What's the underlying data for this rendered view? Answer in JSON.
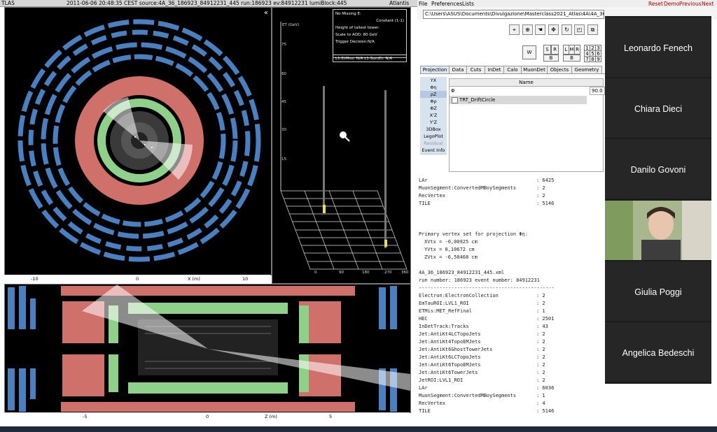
{
  "atlantis": {
    "header": {
      "left": "TLAS",
      "center": "2011-06-06 20:48:35 CEST source:4A_36_186923_84912231_445 run:186923 ev:84912231 lumiBlock:445",
      "right": "Atlantis"
    },
    "yx_axis": {
      "ticks": [
        "-10",
        "0",
        "10"
      ],
      "label": "X (m)"
    },
    "rz_axis": {
      "ticks": [
        "-5",
        "0",
        "5"
      ],
      "label": "Z (m)"
    },
    "lego": {
      "info_lines": [
        "No Missing E:",
        "Constant (1-1)",
        "Height of tallest tower:",
        "Scale to AOD: 80 GeV",
        "Trigger Decision:N/A"
      ],
      "l1_line": "L1-EtMiss: N/A L1-SumEt: N/A",
      "y_title": "ET (GeV)",
      "y_ticks": [
        "75",
        "60",
        "45",
        "30",
        "15"
      ],
      "x_ticks": [
        "0",
        "90",
        "180",
        "270",
        "360"
      ],
      "depth_ticks": [
        "-5",
        "-4",
        "-3",
        "-2",
        "-1",
        "0",
        "1",
        "2",
        "3",
        "4",
        "5"
      ]
    }
  },
  "gui": {
    "menu": [
      "File",
      "Preferences",
      "Lists"
    ],
    "menu_right": [
      "Reset",
      "Demo",
      "Previous",
      "Next"
    ],
    "path": "C:\\Users\\ASUS\\Documents\\Divulgazione\\Masterclass2021_Atlas\\4A\\4A_36_186923_84912231_445.xml",
    "window_buttons": {
      "w": "W",
      "s": "S",
      "r": "R",
      "b": "B",
      "l": "L",
      "m": "M",
      "r2": "R",
      "b2": "B",
      "grid": [
        "1",
        "2",
        "3",
        "4",
        "5",
        "6",
        "7",
        "8",
        "9"
      ]
    },
    "tabs": [
      "Projection",
      "Data",
      "Cuts",
      "InDet",
      "Calo",
      "MuonDet",
      "Objects",
      "Geometry"
    ],
    "projections": [
      "YX",
      "Φη",
      "ρZ",
      "Φρ",
      "ΦZ",
      "X'Z",
      "Y'Z",
      "3DBox",
      "LegoPlot",
      "Residual",
      "Event Info"
    ],
    "table": {
      "header": "Name",
      "row1_label": "Φ",
      "row1_value": "90.0",
      "row2_label": "TRT_DriftCircle"
    },
    "console": {
      "top_lines": [
        {
          "k": "LAr",
          "v": ": 6425"
        },
        {
          "k": "MuonSegment:ConvertedMBoySegments",
          "v": ": 2"
        },
        {
          "k": "RecVertex",
          "v": ": 2"
        },
        {
          "k": "TILE",
          "v": ": 5146"
        }
      ],
      "vertex_title": "Primary vertex set for projection Φη:",
      "vertex_lines": [
        "XVtx = -0,00925 cm",
        "YVtx = 0,10672 cm",
        "ZVtx = -6,50468 cm"
      ],
      "file": "4A_36_186923_84912231_445.xml",
      "run_line": "run number: 186923 event number: 84912231",
      "separator": "----------------------------------------------",
      "collections": [
        {
          "k": "Electron:ElectronCollection",
          "v": ": 2"
        },
        {
          "k": "EmTauROI:LVL1_ROI",
          "v": ": 2"
        },
        {
          "k": "ETMis:MET_RefFinal",
          "v": ": 1"
        },
        {
          "k": "HEC",
          "v": ": 2501"
        },
        {
          "k": "InDetTrack:Tracks",
          "v": ": 43"
        },
        {
          "k": "Jet:AntiKt4LCTopoJets",
          "v": ": 2"
        },
        {
          "k": "Jet:AntiKt4TopoEMJets",
          "v": ": 2"
        },
        {
          "k": "Jet:AntiKt6GhostTowerJets",
          "v": ": 2"
        },
        {
          "k": "Jet:AntiKt6LCTopoJets",
          "v": ": 2"
        },
        {
          "k": "Jet:AntiKt6TopoEMJets",
          "v": ": 2"
        },
        {
          "k": "Jet:AntiKt6TowerJets",
          "v": ": 2"
        },
        {
          "k": "JetROI:LVL1_ROI",
          "v": ": 2"
        },
        {
          "k": "LAr",
          "v": ": 6036"
        },
        {
          "k": "MuonSegment:ConvertedMBoySegments",
          "v": ": 1"
        },
        {
          "k": "RecVertex",
          "v": ": 4"
        },
        {
          "k": "TILE",
          "v": ": 5146"
        }
      ]
    }
  },
  "participants": [
    "Leonardo Fenech",
    "Chiara Dieci",
    "Danilo Govoni",
    "Giulia Poggi",
    "Angelica Bedeschi"
  ],
  "colors": {
    "lar": "#d0706a",
    "tile": "#8fd18a",
    "muon": "#4a7fc0",
    "lego_bar": "#e8e050"
  }
}
